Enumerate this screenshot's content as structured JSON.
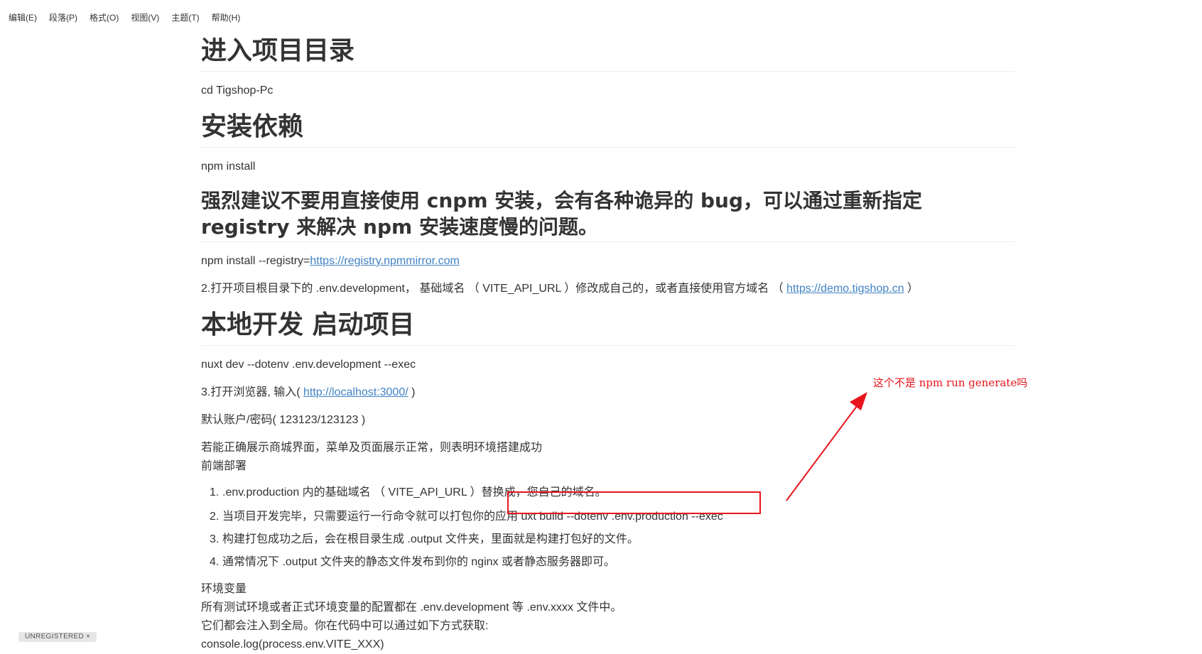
{
  "menu": {
    "items": [
      "编辑(E)",
      "段落(P)",
      "格式(O)",
      "视图(V)",
      "主题(T)",
      "帮助(H)"
    ]
  },
  "doc": {
    "h1_enter": "进入项目目录",
    "p_cd": "cd Tigshop-Pc",
    "h1_install": "安装依赖",
    "p_npm": "npm install",
    "h2_recommend": "强烈建议不要用直接使用 cnpm 安装，会有各种诡异的 bug，可以通过重新指定 registry 来解决 npm 安装速度慢的问题。",
    "p_registry_prefix": "npm install --registry=",
    "p_registry_link": "https://registry.npmmirror.com",
    "p_env_prefix": "2.打开项目根目录下的 .env.development， 基础域名 （ VITE_API_URL ）修改成自己的，或者直接使用官方域名 （ ",
    "p_env_link": "https://demo.tigshop.cn",
    "p_env_suffix": " ）",
    "h1_dev": "本地开发 启动项目",
    "p_nuxt": "nuxt dev --dotenv .env.development --exec",
    "p_browser_prefix": "3.打开浏览器, 输入( ",
    "p_browser_link": "http://localhost:3000/",
    "p_browser_suffix": " )",
    "p_account": "默认账户/密码( 123123/123123 )",
    "p_success": "若能正确展示商城界面，菜单及页面展示正常，则表明环境搭建成功",
    "p_frontend": "前端部署",
    "list": [
      {
        "num": "1.",
        "text": ".env.production 内的基础域名 （ VITE_API_URL ）替换成，您自己的域名。"
      },
      {
        "num": "2.",
        "text": "当项目开发完毕，只需要运行一行命令就可以打包你的应用 uxt build --dotenv .env.production --exec"
      },
      {
        "num": "3.",
        "text": "构建打包成功之后，会在根目录生成 .output 文件夹，里面就是构建打包好的文件。"
      },
      {
        "num": "4.",
        "text": "通常情况下 .output 文件夹的静态文件发布到你的 nginx 或者静态服务器即可。"
      }
    ],
    "p_envvar": "环境变量",
    "p_envvar_desc": "所有测试环境或者正式环境变量的配置都在 .env.development 等 .env.xxxx 文件中。",
    "p_inject": "它们都会注入到全局。你在代码中可以通过如下方式获取:",
    "p_console": "console.log(process.env.VITE_XXX)"
  },
  "annotation": {
    "text": "这个不是 npm run generate吗",
    "color": "#e8141c"
  },
  "status": {
    "badge": "UNREGISTERED ×"
  },
  "colors": {
    "link": "#4183c4",
    "text": "#333333",
    "annotation": "#e8141c"
  }
}
